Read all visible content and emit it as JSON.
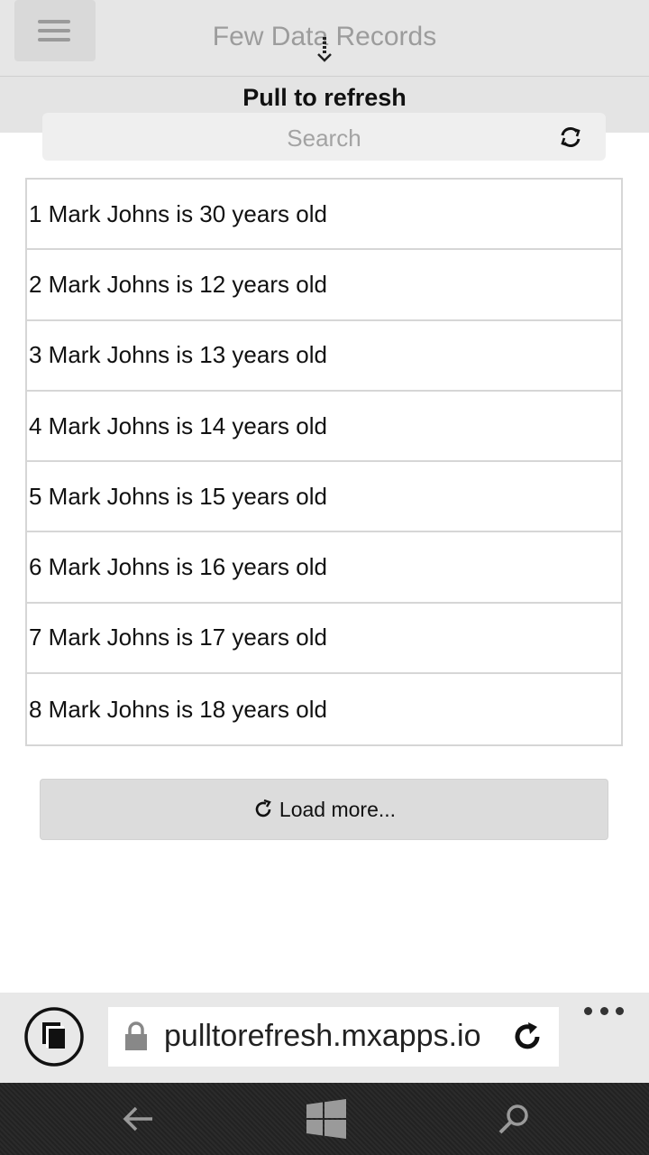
{
  "header": {
    "title": "Few Data Records",
    "menu_icon": "hamburger-menu-icon"
  },
  "pull_to_refresh": {
    "label": "Pull to refresh"
  },
  "search": {
    "placeholder": "Search",
    "refresh_icon": "refresh-icon"
  },
  "list": {
    "items": [
      "1 Mark Johns is 30 years old",
      "2 Mark Johns is 12 years old",
      "3 Mark Johns is 13 years old",
      "4 Mark Johns is 14 years old",
      "5 Mark Johns is 15 years old",
      "6 Mark Johns is 16 years old",
      "7 Mark Johns is 17 years old",
      "8 Mark Johns is 18 years old"
    ]
  },
  "load_more": {
    "label": "Load more..."
  },
  "browser": {
    "url": "pulltorefresh.mxapps.io"
  },
  "colors": {
    "header_bg": "#e6e6e6",
    "nav_bar_bg": "#262626",
    "button_bg": "#dcdcdc"
  }
}
